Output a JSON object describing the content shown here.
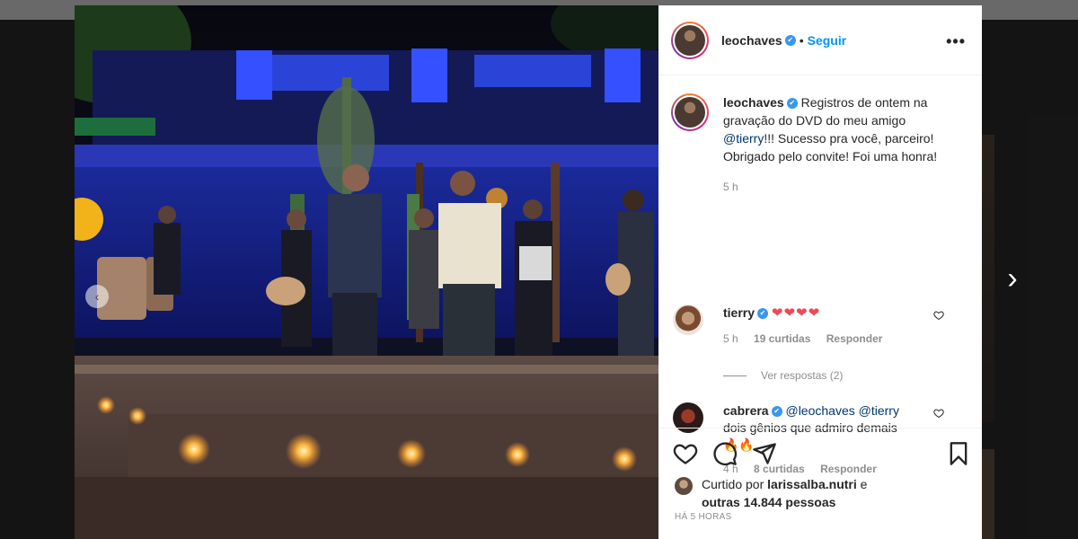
{
  "post": {
    "username": "leochaves",
    "follow_label": "Seguir",
    "dot": "•",
    "more": "•••",
    "caption": {
      "username": "leochaves",
      "text_before": "Registros de ontem na gravação do DVD do meu amigo ",
      "mention": "@tierry",
      "text_after": "!!! Sucesso pra você, parceiro! Obrigado pelo convite! Foi uma honra!",
      "time": "5 h"
    },
    "comments": [
      {
        "username": "tierry",
        "text": "❤❤❤❤",
        "time": "5 h",
        "likes": "19 curtidas",
        "reply": "Responder",
        "view_replies": "Ver respostas (2)"
      },
      {
        "username": "cabrera",
        "mention1": "@leochaves",
        "mention2": "@tierry",
        "text": "dois gênios que admiro demais",
        "emoji": "🔥🔥",
        "time": "4 h",
        "likes": "8 curtidas",
        "reply": "Responder"
      }
    ],
    "liked_by": {
      "prefix": "Curtido por ",
      "user": "larissalba.nutri",
      "suffix": " e",
      "others": "outras 14.844 pessoas"
    },
    "time_ago": "HÁ 5 HORAS"
  },
  "icons": {
    "prev": "‹",
    "next": "›",
    "verified": "✔"
  },
  "colors": {
    "link_blue": "#0095f6",
    "verified_blue": "#3897f0",
    "heart_red": "#ed4956",
    "muted": "#8e8e8e"
  }
}
